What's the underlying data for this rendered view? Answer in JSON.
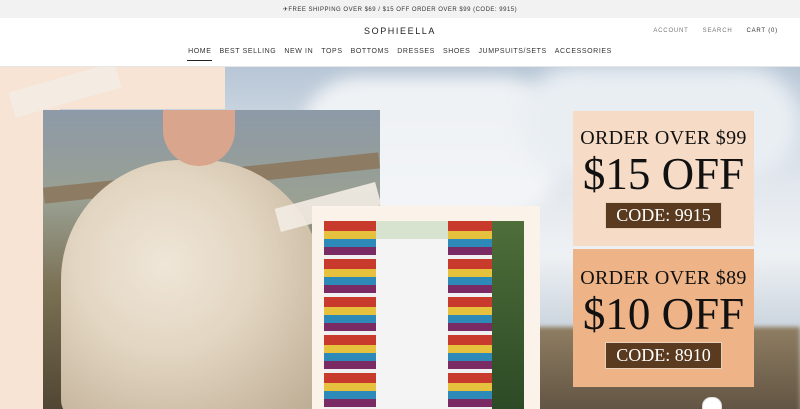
{
  "announcement": {
    "text": "✈FREE SHIPPING OVER $69 / $15 OFF ORDER OVER $99 (CODE: 9915)"
  },
  "brand": {
    "name": "SOPHIEELLA"
  },
  "util": {
    "account": "ACCOUNT",
    "search": "SEARCH",
    "cart": "CART (0)"
  },
  "nav": {
    "items": [
      {
        "label": "HOME",
        "active": true
      },
      {
        "label": "BEST SELLING"
      },
      {
        "label": "NEW IN"
      },
      {
        "label": "TOPS"
      },
      {
        "label": "BOTTOMS"
      },
      {
        "label": "DRESSES"
      },
      {
        "label": "SHOES"
      },
      {
        "label": "JUMPSUITS/SETS"
      },
      {
        "label": "ACCESSORIES"
      }
    ]
  },
  "promos": [
    {
      "headline": "ORDER OVER $99",
      "discount": "$15 OFF",
      "code": "CODE: 9915"
    },
    {
      "headline": "ORDER OVER $89",
      "discount": "$10 OFF",
      "code": "CODE: 8910"
    }
  ],
  "colors": {
    "accent_peach": "#f6dcc6",
    "accent_orange": "#eeb488",
    "code_bg": "#5b3b1f"
  }
}
